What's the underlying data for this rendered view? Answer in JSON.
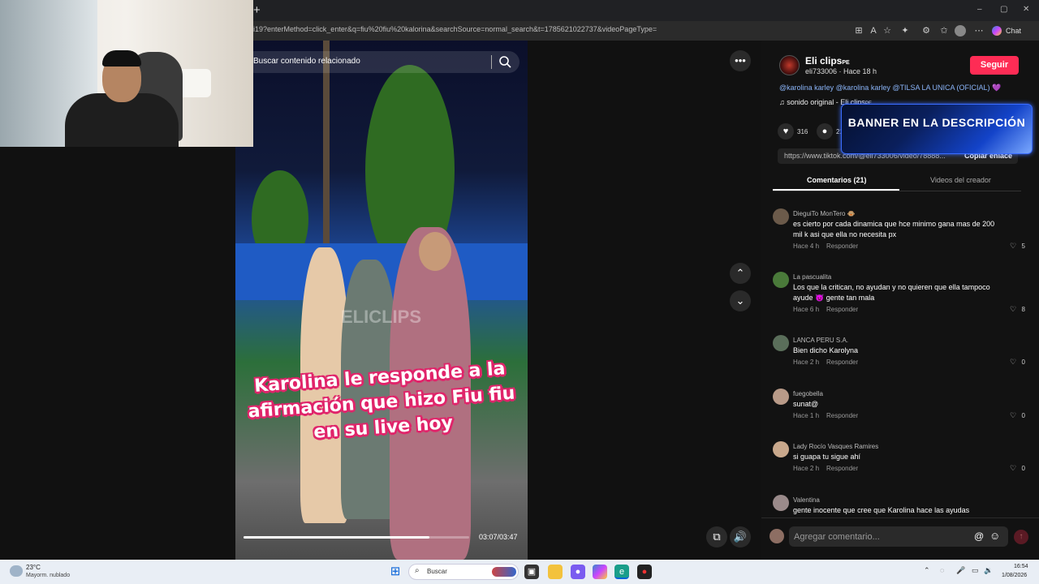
{
  "browser": {
    "new_tab": "+",
    "url": "i19?enterMethod=click_enter&q=fiu%20fiu%20kalorina&searchSource=normal_search&t=1785621022737&videoPageType=",
    "chat_label": "Chat",
    "window_controls": [
      "–",
      "▢",
      "✕"
    ]
  },
  "video": {
    "search_placeholder": "Buscar contenido relacionado",
    "caption": "Karolina le responde a la afirmación que hizo Fiu fiu en su live hoy",
    "watermark": "ELICLIPS",
    "time": "03:07/03:47",
    "progress_fraction": 0.823
  },
  "post": {
    "author": "Eli clips",
    "author_badge": "PE",
    "author_sub": "eli733006 · Hace 18 h",
    "follow": "Seguir",
    "description": "@karolina karley @karolina karley @TILSA LA UNICA (OFICIAL) 💜",
    "sound": "sonido original - Eli clips",
    "sound_badge": "PE",
    "likes": "316",
    "comments_count": "21",
    "link": "https://www.tiktok.com/@eli733006/video/78888...",
    "copy_link": "Copiar enlace",
    "banner": "BANNER EN LA DESCRIPCIÓN"
  },
  "tabs": {
    "comments": "Comentarios (21)",
    "creator_videos": "Videos del creador"
  },
  "comments": [
    {
      "user": "DieguiTo MonTero 🐵",
      "text": "es cierto por cada dinamica que hce minimo gana mas de 200 mil k asi que ella no necesita px",
      "time": "Hace 4 h",
      "reply": "Responder",
      "likes": "5",
      "avatar_color": "#6b5a4a"
    },
    {
      "user": "La pascualita",
      "text": "Los que la critican, no ayudan y no quieren que ella tampoco ayude 👿 gente tan mala",
      "time": "Hace 6 h",
      "reply": "Responder",
      "likes": "8",
      "avatar_color": "#4a7a3a"
    },
    {
      "user": "LANCA PERU S.A.",
      "text": "Bien dicho Karolyna",
      "time": "Hace 2 h",
      "reply": "Responder",
      "likes": "0",
      "avatar_color": "#5a6e5a"
    },
    {
      "user": "fuegobella",
      "text": "sunat@",
      "time": "Hace 1 h",
      "reply": "Responder",
      "likes": "0",
      "avatar_color": "#b89a88"
    },
    {
      "user": "Lady Rocío Vasques Ramires",
      "text": "si guapa tu sigue ahí",
      "time": "Hace 2 h",
      "reply": "Responder",
      "likes": "0",
      "avatar_color": "#c9a88c"
    },
    {
      "user": "Valentina",
      "text": "gente inocente que cree que Karolina hace las ayudas",
      "time": "",
      "reply": "",
      "likes": "",
      "avatar_color": "#9a8a8a"
    }
  ],
  "comment_input": {
    "placeholder": "Agregar comentario..."
  },
  "taskbar": {
    "temperature": "23°C",
    "weather": "Mayorm. nublado",
    "search": "Buscar",
    "time": "16:54",
    "date": "1/08/2026",
    "colors": {
      "accent": "#fe2c55",
      "taskbar": "#e9eef5"
    }
  }
}
